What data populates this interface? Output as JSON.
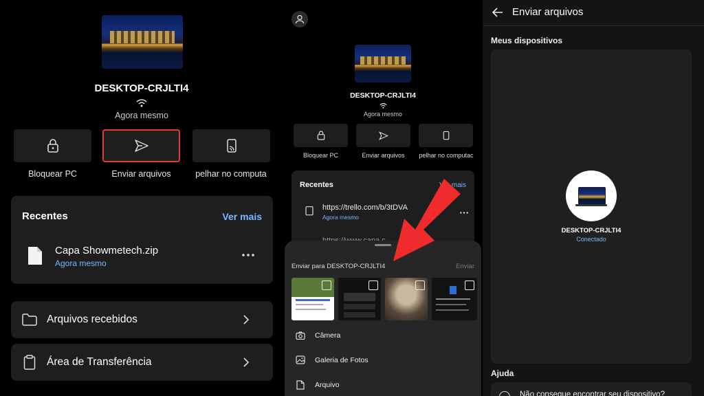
{
  "panel_left": {
    "device_name": "DESKTOP-CRJLTI4",
    "status": "Agora mesmo",
    "actions": [
      {
        "label": "Bloquear PC",
        "icon": "lock-icon"
      },
      {
        "label": "Enviar arquivos",
        "icon": "send-icon"
      },
      {
        "label": "pelhar no computa",
        "icon": "mirror-phone-icon"
      }
    ],
    "recents": {
      "title": "Recentes",
      "see_more": "Ver mais",
      "item": {
        "name": "Capa Showmetech.zip",
        "time": "Agora mesmo",
        "icon": "file-icon"
      }
    },
    "nav": [
      {
        "label": "Arquivos recebidos",
        "icon": "folder-icon"
      },
      {
        "label": "Área de Transferência",
        "icon": "clipboard-icon"
      }
    ],
    "accent_color": "#e53935",
    "link_color": "#7ab8ff"
  },
  "panel_middle": {
    "device_name": "DESKTOP-CRJLTI4",
    "status": "Agora mesmo",
    "actions": [
      {
        "label": "Bloquear PC"
      },
      {
        "label": "Enviar arquivos"
      },
      {
        "label": "pelhar no computac"
      }
    ],
    "recents": {
      "title": "Recentes",
      "see_more": "Ver mais",
      "item1": {
        "url": "https://trello.com/b/3tDVA",
        "time": "Agora mesmo"
      },
      "item2": {
        "url": "https://www.capa.c"
      }
    },
    "sheet": {
      "title": "Enviar para DESKTOP-CRJLTI4",
      "send": "Enviar",
      "options": [
        {
          "label": "Câmera",
          "icon": "camera-icon"
        },
        {
          "label": "Galeria de Fotos",
          "icon": "gallery-icon"
        },
        {
          "label": "Arquivo",
          "icon": "file-icon"
        }
      ]
    },
    "arrow_color": "#ef2b2b"
  },
  "panel_right": {
    "title": "Enviar arquivos",
    "section": "Meus dispositivos",
    "device_name": "DESKTOP-CRJLTI4",
    "device_status": "Conectado",
    "help_title": "Ajuda",
    "help_item": "Não consegue encontrar seu dispositivo?"
  }
}
